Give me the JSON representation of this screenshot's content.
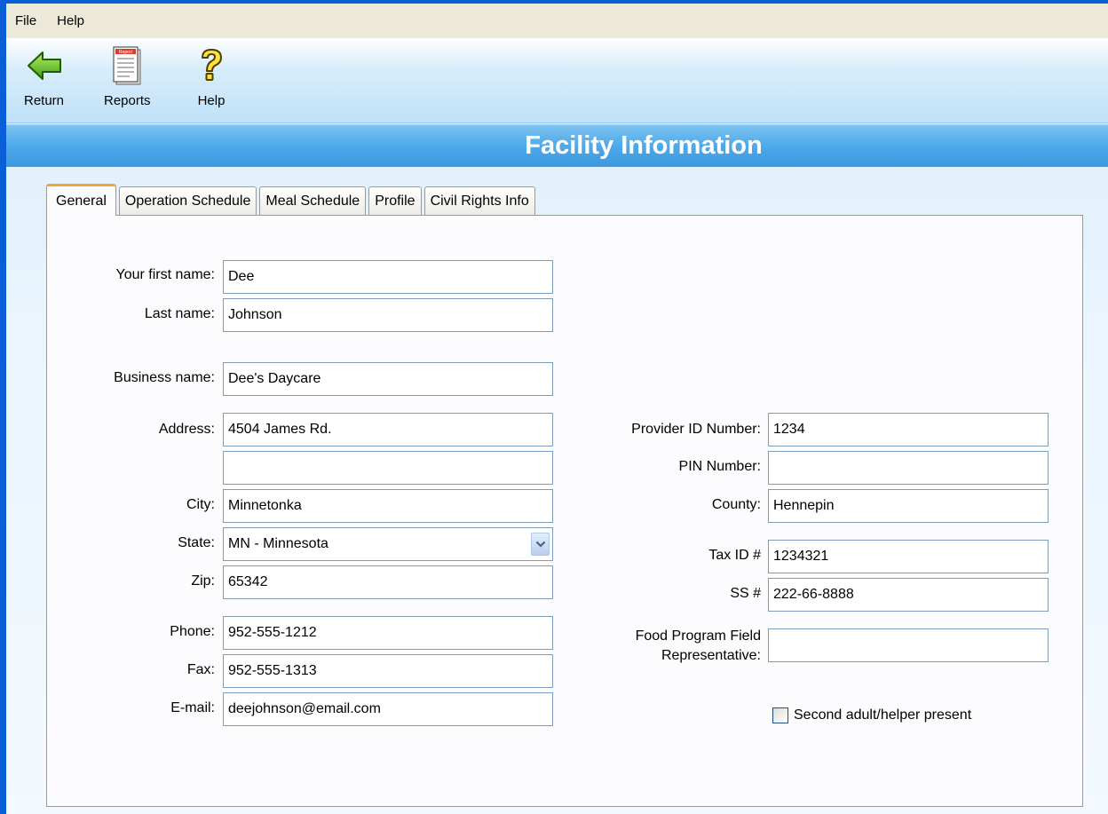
{
  "menu": {
    "items": [
      "File",
      "Help"
    ]
  },
  "toolbar": {
    "return_label": "Return",
    "reports_label": "Reports",
    "help_label": "Help",
    "report_icon_text": "Report"
  },
  "header": {
    "title": "Facility Information"
  },
  "tabs": [
    "General",
    "Operation Schedule",
    "Meal Schedule",
    "Profile",
    "Civil Rights Info"
  ],
  "form": {
    "first_name": {
      "label": "Your first name:",
      "value": "Dee"
    },
    "last_name": {
      "label": "Last name:",
      "value": "Johnson"
    },
    "business_name": {
      "label": "Business name:",
      "value": "Dee's Daycare"
    },
    "address": {
      "label": "Address:",
      "line1": "4504 James Rd.",
      "line2": ""
    },
    "city": {
      "label": "City:",
      "value": "Minnetonka"
    },
    "state": {
      "label": "State:",
      "value": "MN - Minnesota"
    },
    "zip": {
      "label": "Zip:",
      "value": "65342"
    },
    "phone": {
      "label": "Phone:",
      "value": "952-555-1212"
    },
    "fax": {
      "label": "Fax:",
      "value": "952-555-1313"
    },
    "email": {
      "label": "E-mail:",
      "value": "deejohnson@email.com"
    },
    "provider_id": {
      "label": "Provider ID Number:",
      "value": "1234"
    },
    "pin": {
      "label": "PIN Number:",
      "value": ""
    },
    "county": {
      "label": "County:",
      "value": "Hennepin"
    },
    "tax_id": {
      "label": "Tax ID #",
      "value": "1234321"
    },
    "ss": {
      "label": "SS #",
      "value": "222-66-8888"
    },
    "field_rep": {
      "label_line1": "Food Program Field",
      "label_line2": "Representative:",
      "value": ""
    },
    "second_adult": {
      "label": "Second adult/helper present",
      "checked": false
    }
  },
  "colors": {
    "window_frame": "#0a5fd8",
    "banner": "#4ea9ea",
    "active_tab_accent": "#f2a735",
    "field_border": "#7f9db9"
  },
  "icons": [
    "back-arrow-icon",
    "report-icon",
    "help-question-icon",
    "dropdown-arrow-icon"
  ]
}
